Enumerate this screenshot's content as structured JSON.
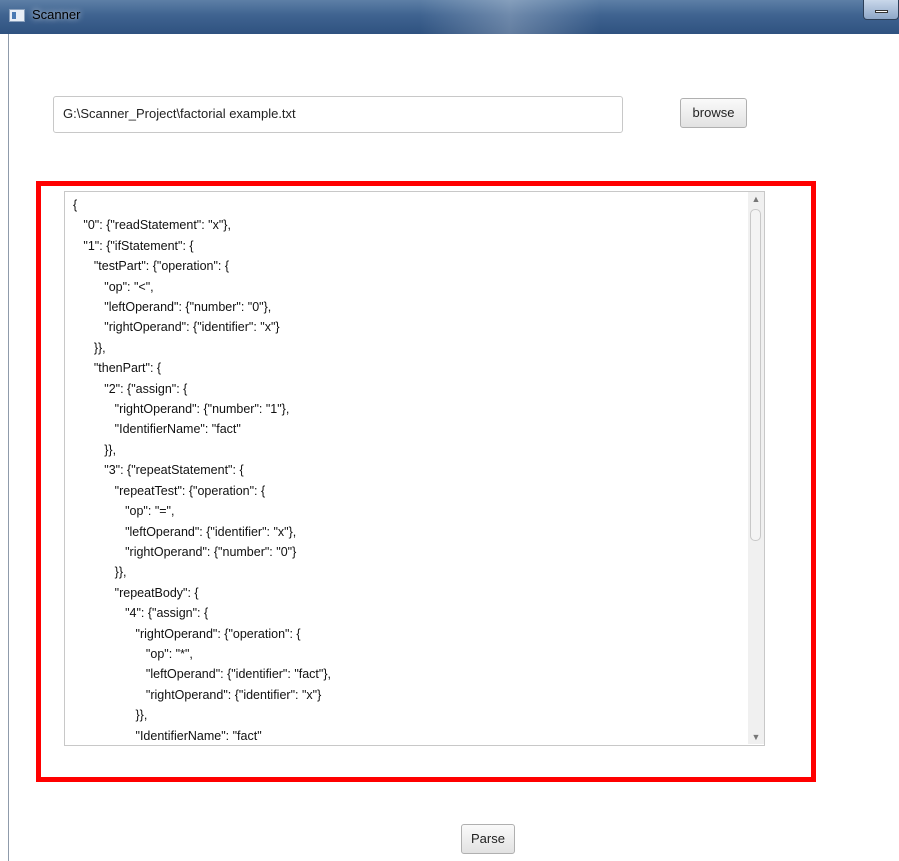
{
  "window": {
    "title": "Scanner",
    "minimize_icon": "minimize-icon"
  },
  "file": {
    "path": "G:\\Scanner_Project\\factorial example.txt",
    "browse_label": "browse"
  },
  "output": {
    "text": "{\n   \"0\": {\"readStatement\": \"x\"},\n   \"1\": {\"ifStatement\": {\n      \"testPart\": {\"operation\": {\n         \"op\": \"<\",\n         \"leftOperand\": {\"number\": \"0\"},\n         \"rightOperand\": {\"identifier\": \"x\"}\n      }},\n      \"thenPart\": {\n         \"2\": {\"assign\": {\n            \"rightOperand\": {\"number\": \"1\"},\n            \"IdentifierName\": \"fact\"\n         }},\n         \"3\": {\"repeatStatement\": {\n            \"repeatTest\": {\"operation\": {\n               \"op\": \"=\",\n               \"leftOperand\": {\"identifier\": \"x\"},\n               \"rightOperand\": {\"number\": \"0\"}\n            }},\n            \"repeatBody\": {\n               \"4\": {\"assign\": {\n                  \"rightOperand\": {\"operation\": {\n                     \"op\": \"*\",\n                     \"leftOperand\": {\"identifier\": \"fact\"},\n                     \"rightOperand\": {\"identifier\": \"x\"}\n                  }},\n                  \"IdentifierName\": \"fact\"",
    "scroll_up_icon": "chevron-up-icon",
    "scroll_down_icon": "chevron-down-icon"
  },
  "actions": {
    "parse_label": "Parse"
  },
  "colors": {
    "highlight": "#ff0000",
    "titlebar": "#3f6390"
  }
}
